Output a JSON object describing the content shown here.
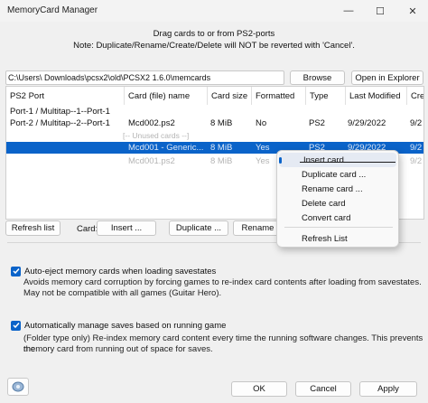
{
  "window": {
    "title": "MemoryCard Manager",
    "minimize": "—",
    "maximize": "☐",
    "close": "✕"
  },
  "header": {
    "line1": "Drag cards to or from PS2-ports",
    "line2": "Note: Duplicate/Rename/Create/Delete will NOT be reverted with 'Cancel'."
  },
  "path": {
    "value": "C:\\Users\\        Downloads\\pcsx2\\old\\PCSX2 1.6.0\\memcards",
    "browse": "Browse",
    "open_explorer": "Open in Explorer"
  },
  "table": {
    "columns": [
      "PS2 Port",
      "Card (file) name",
      "Card size",
      "Formatted",
      "Type",
      "Last Modified",
      "Crea"
    ],
    "rows": [
      {
        "port": "Port-1 / Multitap--1--Port-1",
        "name": "",
        "size": "",
        "formatted": "",
        "type": "",
        "modified": "",
        "created": ""
      },
      {
        "port": "Port-2 / Multitap--2--Port-1",
        "name": "Mcd002.ps2",
        "size": "8 MiB",
        "formatted": "No",
        "type": "PS2",
        "modified": "9/29/2022",
        "created": "9/2"
      },
      {
        "port": "",
        "name": "[-- Unused cards --]",
        "size": "",
        "formatted": "",
        "type": "",
        "modified": "",
        "created": ""
      },
      {
        "port": "",
        "name": "Mcd001 - Generic...",
        "size": "8 MiB",
        "formatted": "Yes",
        "type": "PS2",
        "modified": "9/29/2022",
        "created": "9/2"
      },
      {
        "port": "",
        "name": "Mcd001.ps2",
        "size": "8 MiB",
        "formatted": "Yes",
        "type": "",
        "modified": "",
        "created": "9/2"
      }
    ]
  },
  "context_menu": {
    "items": [
      "Insert card ...",
      "Duplicate card ...",
      "Rename card ...",
      "Delete card",
      "Convert card",
      "Refresh List"
    ]
  },
  "actions": {
    "refresh": "Refresh list",
    "card_label": "Card:",
    "insert": "Insert ...",
    "duplicate": "Duplicate ...",
    "rename": "Rename"
  },
  "options": {
    "auto_eject_label": "Auto-eject memory cards when loading savestates",
    "auto_eject_desc1": "Avoids memory card corruption by forcing games to re-index card contents after loading from savestates.",
    "auto_eject_desc2": "May not be compatible with all games (Guitar Hero).",
    "auto_manage_label": "Automatically manage saves based on running game",
    "auto_manage_desc1": "(Folder type only) Re-index memory card content every time the running software changes. This prevents the",
    "auto_manage_desc2": "memory card from running out of space for saves."
  },
  "footer": {
    "ok": "OK",
    "cancel": "Cancel",
    "apply": "Apply"
  },
  "colors": {
    "accent": "#0a63c9",
    "background": "#f0f0f0"
  }
}
